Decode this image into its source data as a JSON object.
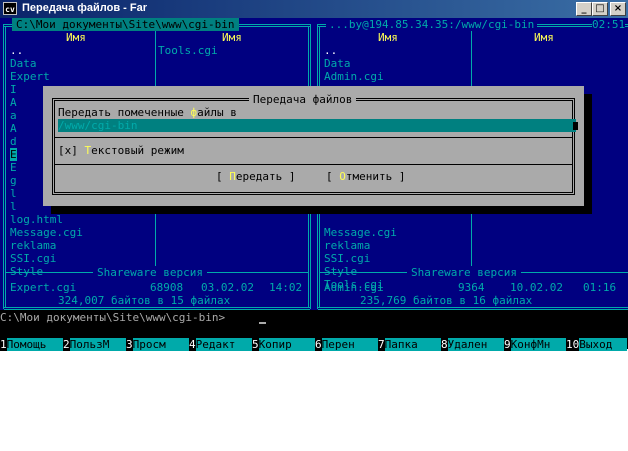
{
  "window": {
    "title": "Передача файлов - Far",
    "icon_text": "cv"
  },
  "left_panel": {
    "path": "C:\\Мои документы\\Site\\www\\cgi-bin",
    "col_header_1": "Имя",
    "col_header_2": "Имя",
    "col1_files": [
      "..",
      "Data",
      "Expert",
      "I",
      "A",
      "a",
      "A",
      "d",
      "E",
      "E",
      "g",
      "l",
      "l",
      "log.html",
      "Message.cgi",
      "reklama",
      "SSI.cgi",
      "Style"
    ],
    "col2_files": [
      "Tools.cgi"
    ],
    "footer_label": "Shareware версия",
    "selected_file": "Expert.cgi",
    "selected_size": "68908",
    "selected_date": "03.02.02",
    "selected_time": "14:02",
    "summary": "324,007 байтов в 15 файлах"
  },
  "right_panel": {
    "path": "...by@194.85.34.35:/www/cgi-bin",
    "clock": "02:51",
    "col_header_1": "Имя",
    "col_header_2": "Имя",
    "col1_files": [
      "..",
      "Data",
      "Admin.cgi",
      "",
      "",
      "",
      "",
      "",
      "",
      "",
      "",
      "",
      "",
      "",
      "Message.cgi",
      "reklama",
      "SSI.cgi",
      "Style",
      "Tools.cgi"
    ],
    "footer_label": "Shareware версия",
    "selected_file": "Admin.cgi",
    "selected_size": "9364",
    "selected_date": "10.02.02",
    "selected_time": "01:16",
    "summary": "235,769 байтов в 16 файлах"
  },
  "dialog": {
    "title": "Передача файлов",
    "prompt_before": "Передать помеченные ",
    "prompt_hotkey": "ф",
    "prompt_after": "айлы в",
    "target_value": "/www/cgi-bin",
    "checkbox_mark": "[x]",
    "checkbox_hotkey": "Т",
    "checkbox_label": "екстовый режим",
    "transfer_hotkey": "П",
    "transfer_label": "ередать",
    "cancel_hotkey": "О",
    "cancel_label": "тменить"
  },
  "command_line": "C:\\Мои документы\\Site\\www\\cgi-bin>",
  "keybar": [
    {
      "n": "1",
      "label": "Помощь"
    },
    {
      "n": "2",
      "label": "ПользМ"
    },
    {
      "n": "3",
      "label": "Просм"
    },
    {
      "n": "4",
      "label": "Редакт"
    },
    {
      "n": "5",
      "label": "Копир"
    },
    {
      "n": "6",
      "label": "Перен"
    },
    {
      "n": "7",
      "label": "Папка"
    },
    {
      "n": "8",
      "label": "Удален"
    },
    {
      "n": "9",
      "label": "КонфМн"
    },
    {
      "n": "10",
      "label": "Выход"
    }
  ],
  "colors": {
    "panel_bg": "#000080",
    "panel_text": "#00aaaa",
    "dialog_bg": "#aaaaaa",
    "input_bg": "#008080",
    "hotkey": "#ffff55"
  }
}
